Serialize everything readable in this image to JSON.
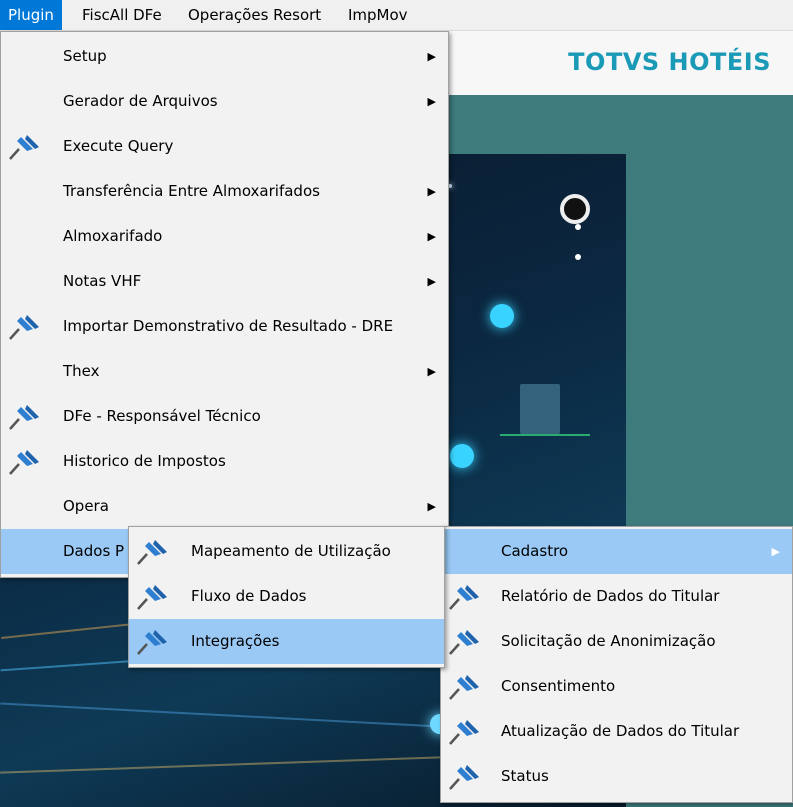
{
  "menubar": {
    "items": [
      {
        "label": "Plugin",
        "active": true
      },
      {
        "label": "FiscAll DFe"
      },
      {
        "label": "Operações Resort"
      },
      {
        "label": "ImpMov"
      }
    ]
  },
  "brand": {
    "name": "TOTVS HOTÉIS",
    "color": "#1a9ab6"
  },
  "plugin_menu": {
    "items": [
      {
        "label": "Setup",
        "submenu": true
      },
      {
        "label": "Gerador de Arquivos",
        "submenu": true
      },
      {
        "label": "Execute Query",
        "icon": "pin-icon"
      },
      {
        "label": "Transferência Entre Almoxarifados",
        "submenu": true
      },
      {
        "label": "Almoxarifado",
        "submenu": true
      },
      {
        "label": "Notas VHF",
        "submenu": true
      },
      {
        "label": "Importar Demonstrativo de Resultado - DRE",
        "icon": "pin-icon"
      },
      {
        "label": "Thex",
        "submenu": true
      },
      {
        "label": "DFe - Responsável Técnico",
        "icon": "pin-icon"
      },
      {
        "label": "Historico de Impostos",
        "icon": "pin-icon"
      },
      {
        "label": "Opera",
        "submenu": true
      },
      {
        "label": "Dados P",
        "submenu": true,
        "highlighted": true
      }
    ]
  },
  "dados_submenu": {
    "items": [
      {
        "label": "Mapeamento de Utilização",
        "icon": "pin-icon"
      },
      {
        "label": "Fluxo de Dados",
        "icon": "pin-icon"
      },
      {
        "label": "Integrações",
        "icon": "pin-icon",
        "highlighted": true
      }
    ]
  },
  "cadastro_submenu": {
    "items": [
      {
        "label": "Cadastro",
        "submenu": true,
        "highlighted": true
      },
      {
        "label": "Relatório de Dados do Titular",
        "icon": "pin-icon"
      },
      {
        "label": "Solicitação de Anonimização",
        "icon": "pin-icon"
      },
      {
        "label": "Consentimento",
        "icon": "pin-icon"
      },
      {
        "label": "Atualização de Dados do Titular",
        "icon": "pin-icon"
      },
      {
        "label": "Status",
        "icon": "pin-icon"
      }
    ]
  },
  "colors": {
    "highlight": "#99c9f4",
    "menubar_active": "#0078d7",
    "workspace": "#3d7b7c",
    "pin": "#2f7fd1"
  }
}
